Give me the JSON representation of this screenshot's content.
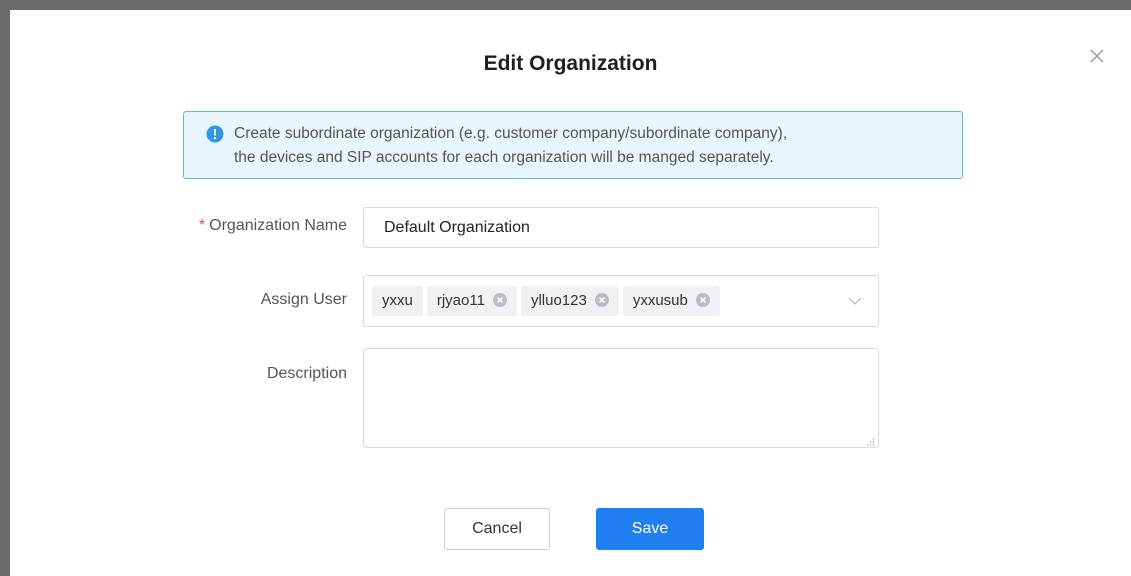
{
  "dialog": {
    "title": "Edit Organization",
    "notice_line1": "Create subordinate organization (e.g. customer company/subordinate company),",
    "notice_line2": "the devices and SIP accounts for each organization will be manged separately."
  },
  "form": {
    "org_name_required_mark": "*",
    "org_name_label": "Organization Name",
    "org_name_value": "Default Organization",
    "assign_user_label": "Assign User",
    "assigned_users": [
      "yxxu",
      "rjyao11",
      "ylluo123",
      "yxxusub"
    ],
    "description_label": "Description",
    "description_value": ""
  },
  "buttons": {
    "cancel_label": "Cancel",
    "save_label": "Save"
  },
  "icons": {
    "close": "close-icon",
    "info": "info-icon",
    "tag_remove": "remove-tag-icon",
    "dropdown": "chevron-down-icon",
    "resize": "resize-handle-icon"
  },
  "colors": {
    "primary": "#1f7ff0",
    "info_border": "#67b3e8",
    "info_bg": "#e9f5fd",
    "required": "#e34d3a"
  }
}
